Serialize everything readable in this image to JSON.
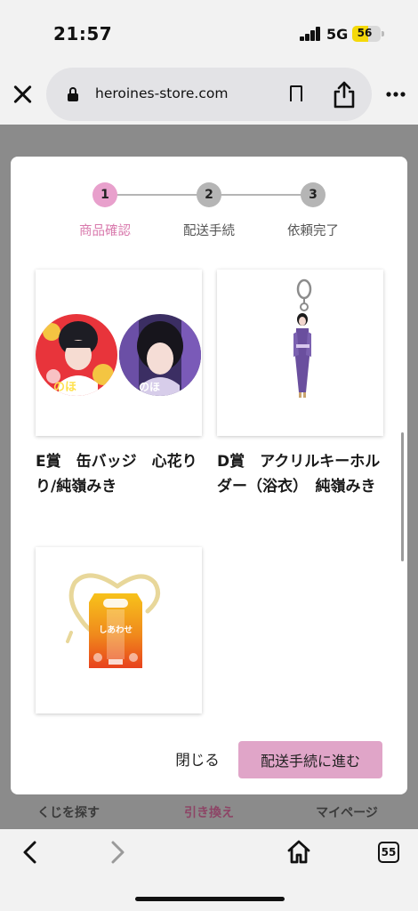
{
  "status_bar": {
    "time": "21:57",
    "network": "5G",
    "battery_level": "56",
    "battery_fraction": 0.56
  },
  "browser": {
    "url": "heroines-store.com",
    "icons": [
      "close-icon",
      "lock-icon",
      "bookmark-icon",
      "share-icon",
      "more-icon"
    ]
  },
  "steps": [
    {
      "number": "1",
      "label": "商品確認",
      "active": true
    },
    {
      "number": "2",
      "label": "配送手続",
      "active": false
    },
    {
      "number": "3",
      "label": "依頼完了",
      "active": false
    }
  ],
  "products": [
    {
      "title": "E賞　缶バッジ　心花りり/純嶺みき"
    },
    {
      "title": "D賞　アクリルキーホルダー（浴衣）　純嶺みき"
    },
    {
      "title": "",
      "image_text": "しあわせ"
    }
  ],
  "modal_buttons": {
    "close_label": "閉じる",
    "next_label": "配送手続に進む"
  },
  "app_tabs": [
    {
      "label": "くじを探す"
    },
    {
      "label": "引き換え",
      "active": true
    },
    {
      "label": "マイページ"
    }
  ],
  "bottom_toolbar": {
    "tab_count": "55"
  },
  "colors": {
    "accent_pink": "#e0a5c8",
    "step_active": "#e8a0cc",
    "step_active_label": "#d97aad",
    "step_inactive": "#b5b5b5",
    "overlay": "#8b8b8b"
  }
}
